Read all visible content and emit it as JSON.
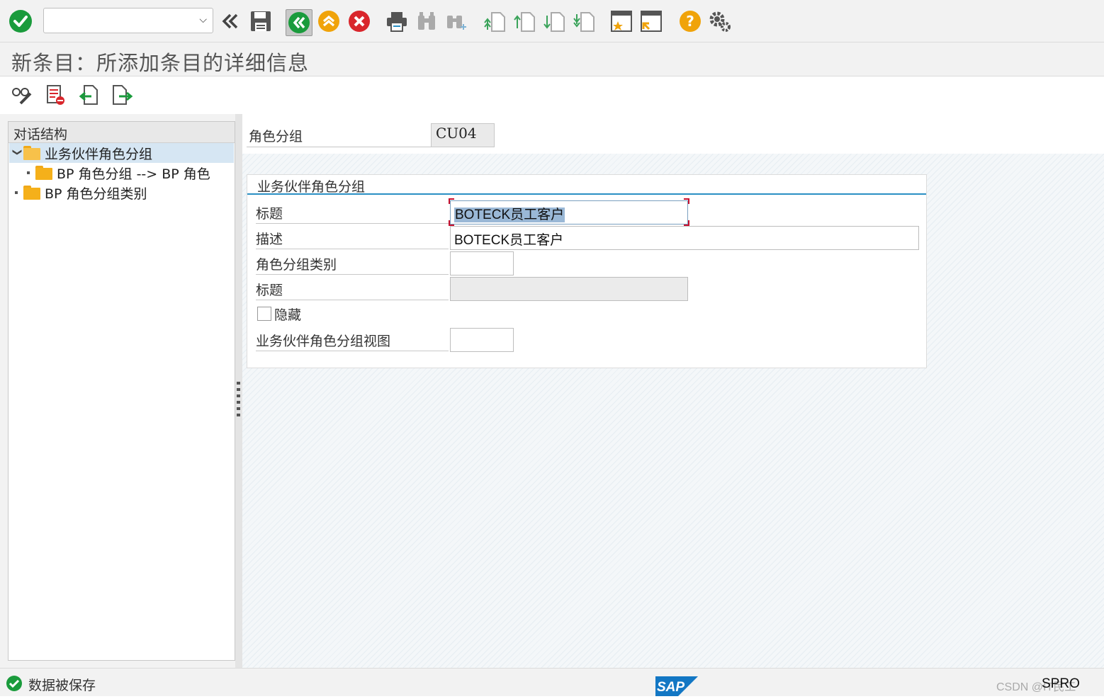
{
  "toolbar": {
    "command_value": "",
    "icons": [
      "enter-icon",
      "back-double-chevron-icon",
      "save-icon",
      "back-icon",
      "exit-icon",
      "cancel-icon",
      "print-icon",
      "find-icon",
      "find-next-icon",
      "first-page-icon",
      "previous-page-icon",
      "next-page-icon",
      "last-page-icon",
      "new-session-icon",
      "shortcut-icon",
      "help-icon",
      "settings-icon"
    ],
    "colors": {
      "green": "#1a9b3c",
      "orange": "#f0a30a",
      "red": "#d9262c",
      "gray": "#8c8c8c"
    }
  },
  "title": "新条目：所添加条目的详细信息",
  "app_toolbar": {
    "icons": [
      "display-change-icon",
      "delete-icon",
      "previous-entry-icon",
      "next-entry-icon"
    ]
  },
  "tree": {
    "header": "对话结构",
    "nodes": [
      {
        "label": "业务伙伴角色分组",
        "selected": true,
        "expanded": true,
        "level": 0
      },
      {
        "label": "BP 角色分组 --> BP 角色",
        "selected": false,
        "expanded": false,
        "level": 1
      },
      {
        "label": "BP 角色分组类别",
        "selected": false,
        "expanded": false,
        "level": 0
      }
    ]
  },
  "header_form": {
    "label": "角色分组",
    "value": "CU04"
  },
  "group": {
    "title": "业务伙伴角色分组",
    "fields": {
      "title_label": "标题",
      "title_value": "BOTECK员工客户",
      "desc_label": "描述",
      "desc_value": "BOTECK员工客户",
      "category_label": "角色分组类别",
      "category_value": "",
      "category_title_label": "标题",
      "category_title_value": "",
      "hidden_label": "隐藏",
      "hidden_checked": false,
      "view_label": "业务伙伴角色分组视图",
      "view_value": ""
    }
  },
  "status": {
    "message": "数据被保存",
    "transaction": "SPRO",
    "watermark": "CSDN @IT民工"
  }
}
